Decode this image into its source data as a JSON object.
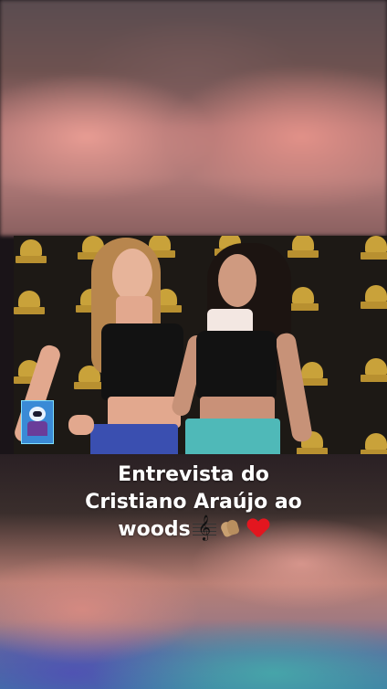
{
  "story": {
    "caption_lines": [
      "Entrevista  do",
      "Cristiano Araújo ao",
      "woods"
    ],
    "caption_emojis": [
      "music-score-icon",
      "clapping-hands-icon",
      "red-heart-icon"
    ]
  },
  "colors": {
    "caption_text": "#ffffff",
    "heart": "#e3161f",
    "backdrop_logo": "#c9a23a"
  }
}
